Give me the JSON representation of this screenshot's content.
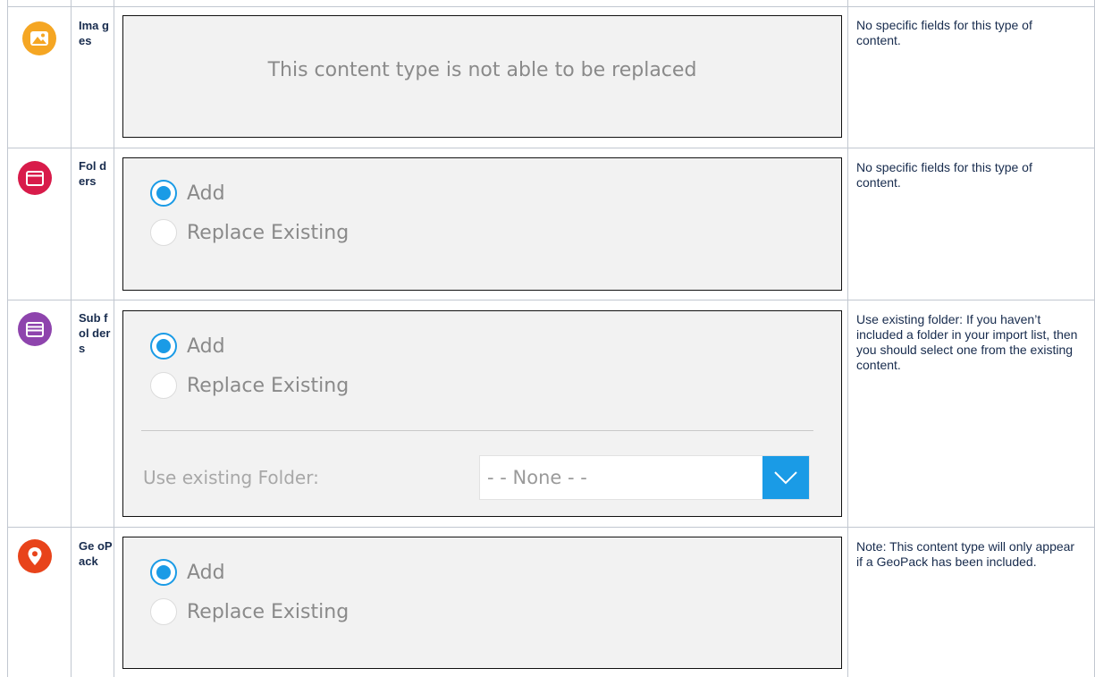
{
  "rows": [
    {
      "name": "Images",
      "name_display": "Ima ges",
      "icon": "image-icon",
      "icon_color": "#f5a623",
      "message": "This content type is not able to be replaced",
      "description": "No specific fields for this type of content."
    },
    {
      "name": "Folders",
      "name_display": "Fol ders",
      "icon": "folder-icon",
      "icon_color": "#d81b4a",
      "options": {
        "add": "Add",
        "replace": "Replace Existing",
        "selected": "Add"
      },
      "description": "No specific fields for this type of content."
    },
    {
      "name": "Subfolders",
      "name_display": "Sub fol ders",
      "icon": "open-folder-icon",
      "icon_color": "#8e44ad",
      "options": {
        "add": "Add",
        "replace": "Replace Existing",
        "selected": "Add"
      },
      "field_label": "Use existing Folder:",
      "select_value": "- - None - -",
      "description": "Use existing folder: If you haven’t included a folder in your import list, then you should select one from the existing content."
    },
    {
      "name": "GeoPack",
      "name_display": "Ge oP ack",
      "icon": "map-pin-icon",
      "icon_color": "#e8431a",
      "options": {
        "add": "Add",
        "replace": "Replace Existing",
        "selected": "Add"
      },
      "description": "Note: This content type will only appear if a GeoPack has been included."
    }
  ],
  "colors": {
    "accent": "#1a9be6",
    "border": "#c1c7d0",
    "panel_bg": "#f2f2f2"
  }
}
